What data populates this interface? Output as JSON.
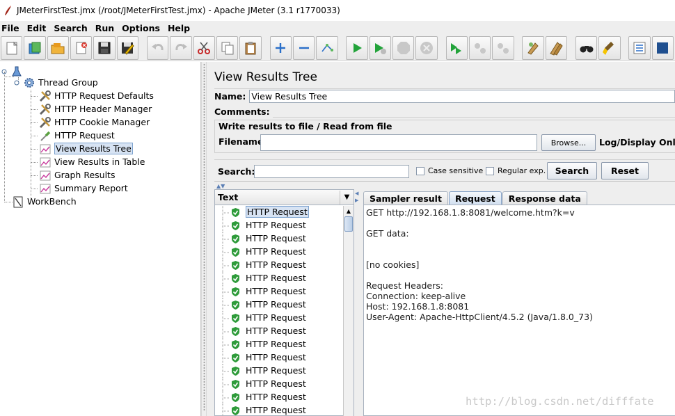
{
  "window": {
    "title": "JMeterFirstTest.jmx (/root/JMeterFirstTest.jmx) - Apache JMeter (3.1 r1770033)"
  },
  "menu": [
    "File",
    "Edit",
    "Search",
    "Run",
    "Options",
    "Help"
  ],
  "toolbar": {
    "buttons": [
      "new-icon",
      "templates-icon",
      "open-icon",
      "close-icon",
      "save-icon",
      "save-as-icon",
      "undo-icon",
      "redo-icon",
      "cut-icon",
      "copy-icon",
      "paste-icon",
      "expand-icon",
      "collapse-icon",
      "toggle-icon",
      "start-icon",
      "start-no-pause-icon",
      "stop-icon",
      "shutdown-icon",
      "remote-start-icon",
      "remote-stop-icon",
      "remote-shutdown-icon",
      "clear-icon",
      "clear-all-icon",
      "search-icon",
      "reset-search-icon",
      "function-helper-icon",
      "help-icon"
    ]
  },
  "tree": {
    "root": "",
    "thread_group": "Thread Group",
    "children": [
      {
        "label": "HTTP Request Defaults",
        "icon": "wrench-icon"
      },
      {
        "label": "HTTP Header Manager",
        "icon": "wrench-icon"
      },
      {
        "label": "HTTP Cookie Manager",
        "icon": "wrench-icon"
      },
      {
        "label": "HTTP Request",
        "icon": "pipette-icon"
      },
      {
        "label": "View Results Tree",
        "icon": "graph-icon",
        "selected": true
      },
      {
        "label": "View Results in Table",
        "icon": "graph-icon"
      },
      {
        "label": "Graph Results",
        "icon": "graph-icon"
      },
      {
        "label": "Summary Report",
        "icon": "graph-icon"
      }
    ],
    "workbench": "WorkBench"
  },
  "panel": {
    "title": "View Results Tree",
    "name_label": "Name:",
    "name_value": "View Results Tree",
    "comments_label": "Comments:",
    "file_group_title": "Write results to file / Read from file",
    "filename_label": "Filename",
    "filename_value": "",
    "browse_label": "Browse...",
    "log_display_label": "Log/Display Only"
  },
  "search": {
    "label": "Search:",
    "value": "",
    "case_sensitive_label": "Case sensitive",
    "case_sensitive_checked": false,
    "regex_label": "Regular exp.",
    "regex_checked": false,
    "search_button": "Search",
    "reset_button": "Reset"
  },
  "results": {
    "renderer": "Text",
    "rows": [
      {
        "label": "HTTP Request",
        "status": "success",
        "selected": true
      },
      {
        "label": "HTTP Request",
        "status": "success"
      },
      {
        "label": "HTTP Request",
        "status": "success"
      },
      {
        "label": "HTTP Request",
        "status": "success"
      },
      {
        "label": "HTTP Request",
        "status": "success"
      },
      {
        "label": "HTTP Request",
        "status": "success"
      },
      {
        "label": "HTTP Request",
        "status": "success"
      },
      {
        "label": "HTTP Request",
        "status": "success"
      },
      {
        "label": "HTTP Request",
        "status": "success"
      },
      {
        "label": "HTTP Request",
        "status": "success"
      },
      {
        "label": "HTTP Request",
        "status": "success"
      },
      {
        "label": "HTTP Request",
        "status": "success"
      },
      {
        "label": "HTTP Request",
        "status": "success"
      },
      {
        "label": "HTTP Request",
        "status": "success"
      },
      {
        "label": "HTTP Request",
        "status": "success"
      },
      {
        "label": "HTTP Request",
        "status": "success"
      }
    ]
  },
  "tabs": [
    {
      "label": "Sampler result",
      "active": false
    },
    {
      "label": "Request",
      "active": true
    },
    {
      "label": "Response data",
      "active": false
    }
  ],
  "request_detail": {
    "lines": [
      "GET http://192.168.1.8:8081/welcome.htm?k=v",
      "",
      "GET data:",
      "",
      "",
      "[no cookies]",
      "",
      "Request Headers:",
      "Connection: keep-alive",
      "Host: 192.168.1.8:8081",
      "User-Agent: Apache-HttpClient/4.5.2 (Java/1.8.0_73)"
    ]
  },
  "watermark": "http://blog.csdn.net/difffate",
  "colors": {
    "selection_bg": "#d7e3f3",
    "selection_border": "#7da2ce",
    "success_green": "#2e9b3a",
    "panel_bg": "#eeeeee"
  }
}
